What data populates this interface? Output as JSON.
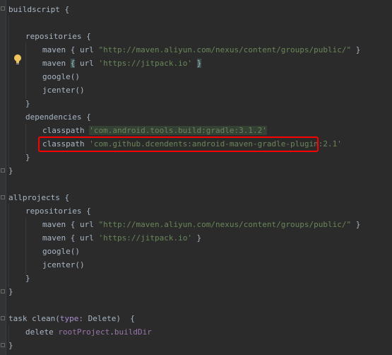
{
  "editor": {
    "lines": [
      {
        "text": "buildscript {"
      },
      {
        "text": "repositories {"
      },
      {
        "a": "maven { url ",
        "b": "\"http://maven.aliyun.com/nexus/content/groups/public/\"",
        "c": " }"
      },
      {
        "a": "maven ",
        "b": "{",
        "c": " url ",
        "d": "'https://jitpack.io'",
        "e": " ",
        "f": "}"
      },
      {
        "text": "google()"
      },
      {
        "text": "jcenter()"
      },
      {
        "text": "}"
      },
      {
        "text": "dependencies {"
      },
      {
        "a": "classpath ",
        "b": "'com.android.tools.build:gradle:3.1.2'"
      },
      {
        "a": "classpath ",
        "b": "'com.github.dcendents:android-maven-gradle-plugin:2.1'"
      },
      {
        "text": "}"
      },
      {
        "text": "}"
      },
      {
        "text": "allprojects {"
      },
      {
        "text": "repositories {"
      },
      {
        "a": "maven { url ",
        "b": "\"http://maven.aliyun.com/nexus/content/groups/public/\"",
        "c": " }"
      },
      {
        "a": "maven { url ",
        "b": "'https://jitpack.io'",
        "c": " }"
      },
      {
        "text": "google()"
      },
      {
        "text": "jcenter()"
      },
      {
        "text": "}"
      },
      {
        "text": "}"
      },
      {
        "a": "task clean(",
        "b": "type:",
        "c": " Delete)  {"
      },
      {
        "a": "delete ",
        "b": "rootProject",
        "c": ".",
        "d": "buildDir"
      },
      {
        "text": "}"
      }
    ]
  },
  "icons": {
    "intention": "lightbulb-icon"
  },
  "colors": {
    "background": "#2b2b2b",
    "string": "#6a8759",
    "highlight_box": "#ff0000"
  }
}
